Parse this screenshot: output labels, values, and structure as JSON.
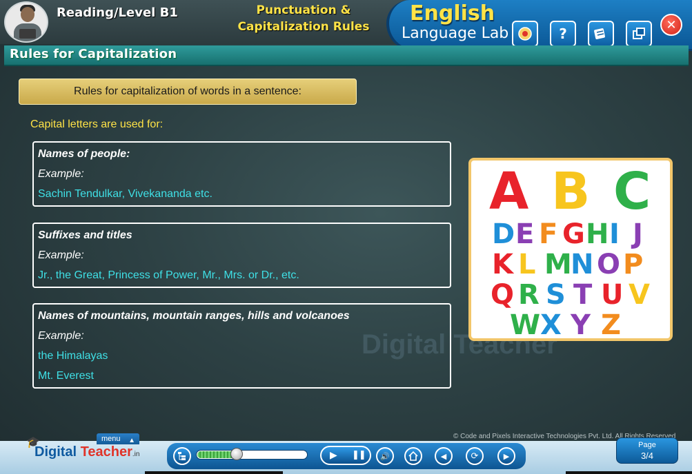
{
  "header": {
    "level_title": "Reading/Level B1",
    "topic_title_line1": "Punctuation &",
    "topic_title_line2": "Capitalization Rules",
    "brand_line1": "English",
    "brand_line2": "Language Lab",
    "tools": [
      {
        "icon": "glossary-icon"
      },
      {
        "icon": "help-icon",
        "glyph": "?"
      },
      {
        "icon": "notes-icon"
      },
      {
        "icon": "window-icon"
      }
    ],
    "close_glyph": "✕"
  },
  "section": {
    "title": "Rules for Capitalization"
  },
  "intro": "Rules for capitalization of words in a sentence:",
  "lead": "Capital letters are used for:",
  "rules": [
    {
      "heading": "Names of people:",
      "example_label": "Example:",
      "examples": [
        "Sachin Tendulkar, Vivekananda etc."
      ]
    },
    {
      "heading": "Suffixes and titles",
      "example_label": "Example:",
      "examples": [
        "Jr., the Great, Princess of Power, Mr., Mrs. or Dr., etc."
      ]
    },
    {
      "heading": "Names of mountains, mountain ranges, hills and volcanoes",
      "example_label": "Example:",
      "examples": [
        "the Himalayas",
        "Mt. Everest"
      ]
    }
  ],
  "alphabet": {
    "rows": [
      "ABC",
      "DEFGHIJ",
      "KLMNOP",
      "QRSTUV",
      "WXYZ"
    ]
  },
  "watermark": "Digital Teacher",
  "copyright": "© Code and Pixels Interactive Technologies  Pvt. Ltd. All Rights Reserved",
  "footer": {
    "logo_main": "Digital",
    "logo_accent": " Teacher",
    "logo_suffix": ".in",
    "menu_label": "menu",
    "progress_fraction": 0.35,
    "page_label": "Page",
    "page_number": "3/4"
  },
  "colors": {
    "accent_yellow": "#ffe347",
    "example_cyan": "#3fe0e6",
    "brand_blue": "#1d7fc4",
    "section_teal": "#2f9b9b",
    "close_red": "#d32418"
  }
}
